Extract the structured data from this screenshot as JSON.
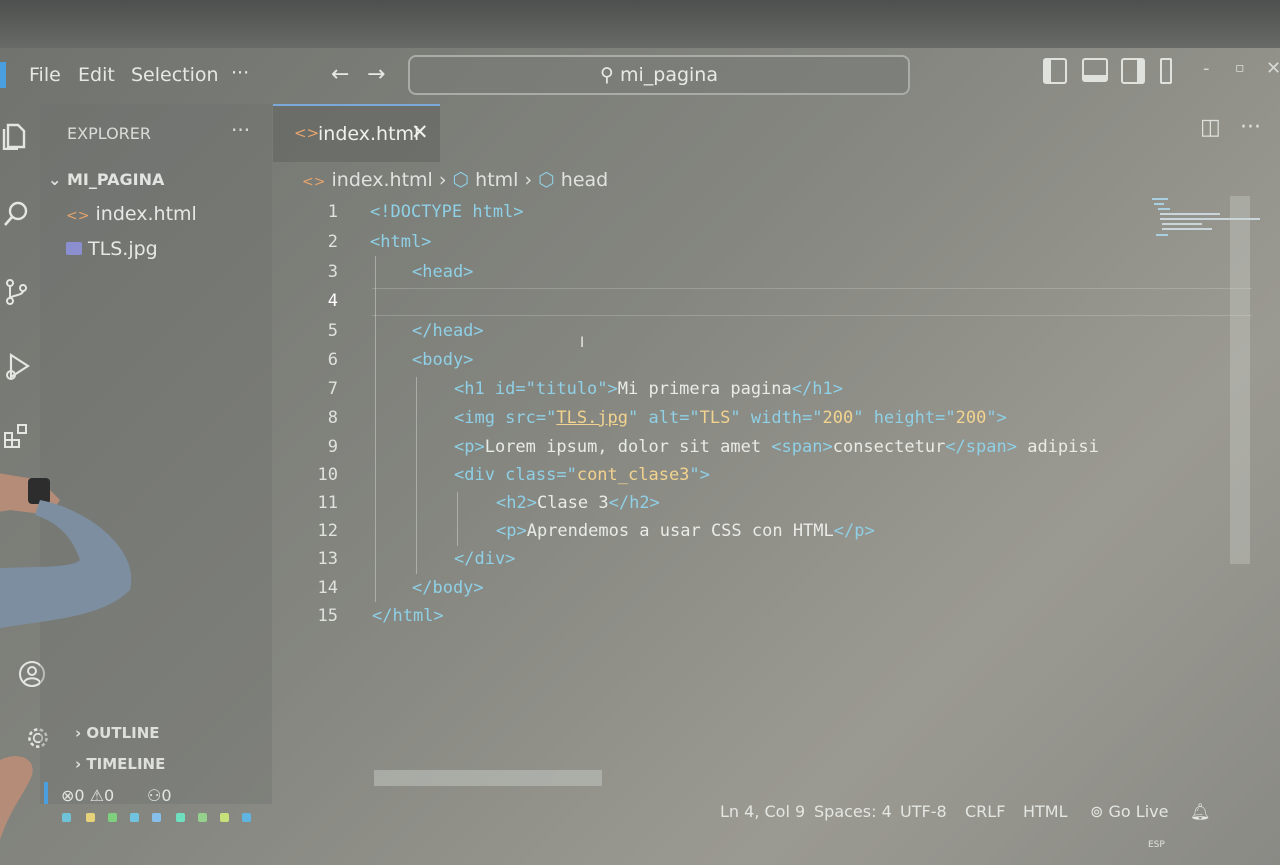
{
  "menu": {
    "file": "File",
    "edit": "Edit",
    "selection": "Selection",
    "more": "···"
  },
  "search": {
    "text": "mi_pagina"
  },
  "explorer": {
    "title": "EXPLORER",
    "more": "···",
    "folder": "MI_PAGINA",
    "files": [
      {
        "name": "index.html"
      },
      {
        "name": "TLS.jpg"
      }
    ],
    "outline": "OUTLINE",
    "timeline": "TIMELINE"
  },
  "tab": {
    "label": "index.html",
    "close": "✕"
  },
  "editor_tools": {
    "more": "···"
  },
  "breadcrumb": {
    "file": "index.html",
    "html": "html",
    "head": "head"
  },
  "code": {
    "line_numbers": [
      "1",
      "2",
      "3",
      "4",
      "5",
      "6",
      "7",
      "8",
      "9",
      "10",
      "11",
      "12",
      "13",
      "14",
      "15"
    ],
    "l1_doctype": "<!DOCTYPE html>",
    "l2": "<html>",
    "l3": "<head>",
    "l5": "</head>",
    "l6": "<body>",
    "l7_open": "<h1 id=\"titulo\">",
    "l7_text": "Mi primera pagina",
    "l7_close": "</h1>",
    "l8_tag": "<img src=\"",
    "l8_src": "TLS.jpg",
    "l8_rest_a": "\" alt=\"",
    "l8_alt": "TLS",
    "l8_rest_b": "\" width=\"",
    "l8_w": "200",
    "l8_rest_c": "\" height=\"",
    "l8_h": "200",
    "l8_end": "\">",
    "l9_open": "<p>",
    "l9_text": "Lorem ipsum, dolor sit amet ",
    "l9_span_open": "<span>",
    "l9_span_text": "consectetur",
    "l9_span_close": "</span>",
    "l9_rest": " adipisi",
    "l10_tag": "<div class=\"",
    "l10_cls": "cont_clase3",
    "l10_end": "\">",
    "l11_open": "<h2>",
    "l11_text": "Clase 3",
    "l11_close": "</h2>",
    "l12_open": "<p>",
    "l12_text": "Aprendemos a usar CSS con HTML",
    "l12_close": "</p>",
    "l13": "</div>",
    "l14": "</body>",
    "l15": "</html>"
  },
  "status": {
    "errors": "0",
    "warnings": "0",
    "ports": "0",
    "position": "Ln 4, Col 9",
    "spaces": "Spaces: 4",
    "encoding": "UTF-8",
    "eol": "CRLF",
    "language": "HTML",
    "golive": "Go Live"
  },
  "taskbar": {
    "lang": "ESP"
  }
}
